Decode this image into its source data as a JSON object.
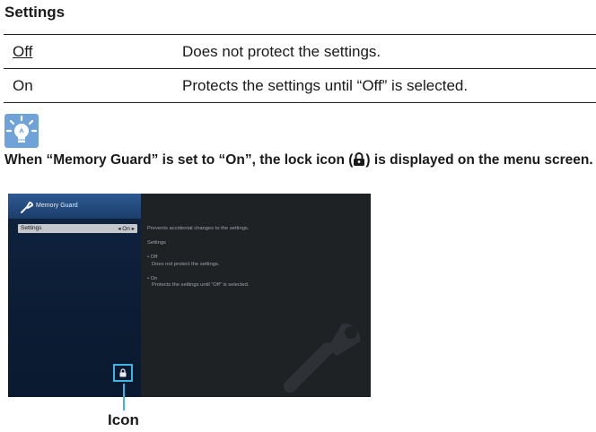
{
  "section": {
    "title": "Settings"
  },
  "settings_table": {
    "rows": [
      {
        "option": "Off",
        "description": "Does not protect the settings."
      },
      {
        "option": "On",
        "description": "Protects the settings until “Off” is selected."
      }
    ]
  },
  "tip": {
    "icon": "lightbulb-icon",
    "text_before": "When “Memory Guard” is set to “On”, the lock icon (",
    "text_after": ") is displayed on the menu screen."
  },
  "screen": {
    "header_title": "Memory Guard",
    "menu_label": "Settings",
    "menu_value": "◂ On ▸",
    "info": {
      "intro": "Prevents accidental changes to the settings.",
      "heading": "Settings",
      "off_title": "• Off",
      "off_desc": "Does not protect the settings.",
      "on_title": "• On",
      "on_desc": "Protects the settings until “Off” is selected."
    },
    "accent_color": "#3db4e4"
  },
  "callout": {
    "label": "Icon"
  }
}
